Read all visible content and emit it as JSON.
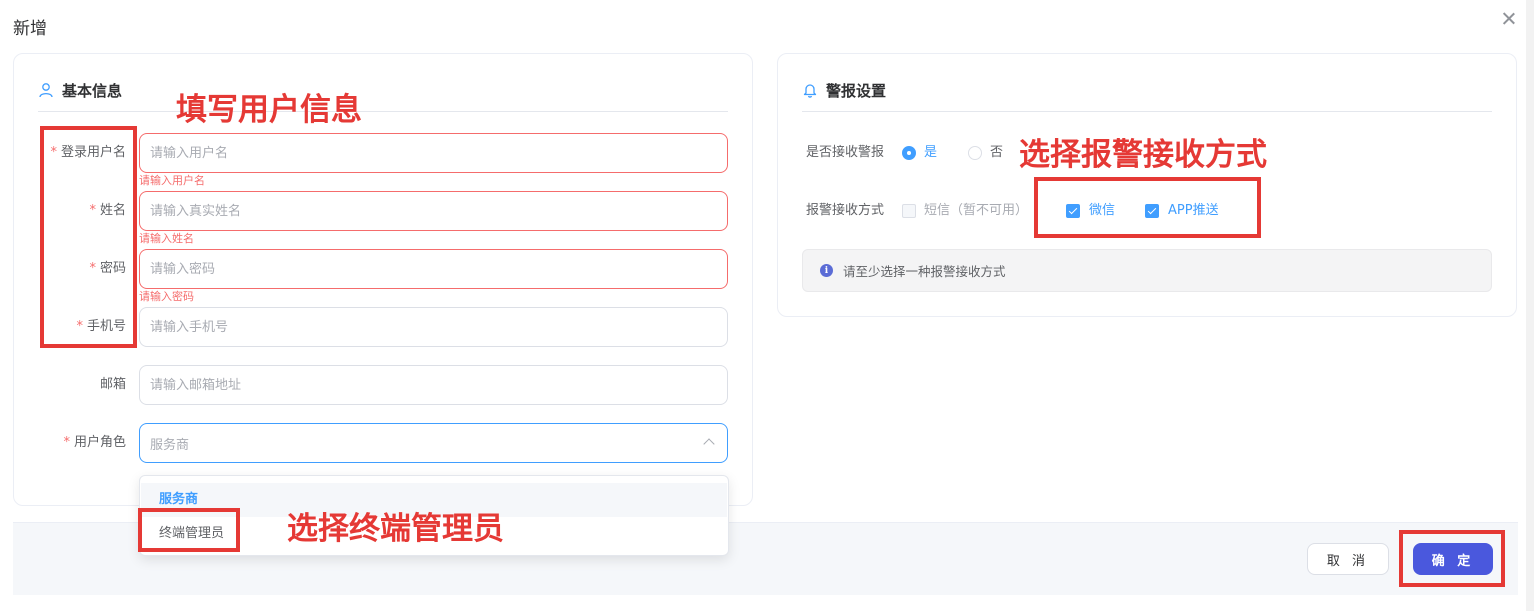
{
  "dialog": {
    "title": "新增"
  },
  "basic_info": {
    "title": "基本信息",
    "fields": [
      {
        "label": "登录用户名",
        "required": true,
        "placeholder": "请输入用户名",
        "error": "请输入用户名"
      },
      {
        "label": "姓名",
        "required": true,
        "placeholder": "请输入真实姓名",
        "error": "请输入姓名"
      },
      {
        "label": "密码",
        "required": true,
        "placeholder": "请输入密码",
        "error": "请输入密码"
      },
      {
        "label": "手机号",
        "required": true,
        "placeholder": "请输入手机号"
      },
      {
        "label": "邮箱",
        "required": false,
        "placeholder": "请输入邮箱地址"
      }
    ],
    "role": {
      "label": "用户角色",
      "required": true,
      "value": "服务商",
      "options": [
        "服务商",
        "终端管理员"
      ]
    }
  },
  "alarm_settings": {
    "title": "警报设置",
    "receive_label": "是否接收警报",
    "receive_options": [
      {
        "label": "是",
        "checked": true
      },
      {
        "label": "否",
        "checked": false
      }
    ],
    "method_label": "报警接收方式",
    "methods": [
      {
        "label": "短信（暂不可用）",
        "checked": false,
        "disabled": true
      },
      {
        "label": "微信",
        "checked": true
      },
      {
        "label": "APP推送",
        "checked": true
      }
    ],
    "notice": "请至少选择一种报警接收方式"
  },
  "footer": {
    "cancel": "取 消",
    "confirm": "确 定"
  },
  "annotations": {
    "fill_user_info": "填写用户信息",
    "choose_alarm_method": "选择报警接收方式",
    "choose_terminal_admin": "选择终端管理员"
  },
  "colors": {
    "primary": "#409eff",
    "confirm": "#4a58dd",
    "error": "#f56c6c",
    "annotation": "#e53935"
  }
}
